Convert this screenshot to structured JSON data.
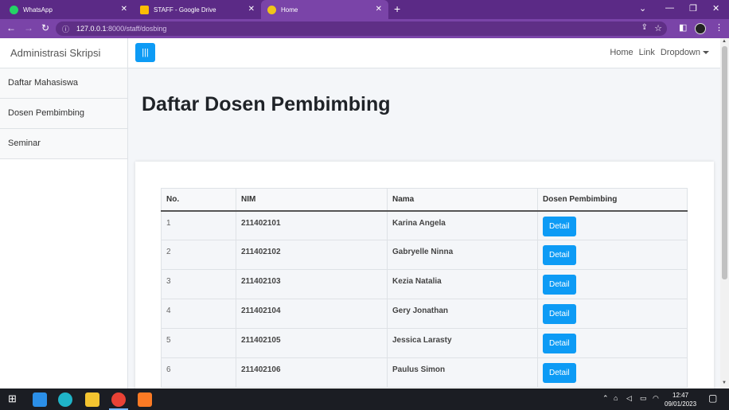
{
  "browser": {
    "tabs": [
      {
        "label": "WhatsApp",
        "color": "#25d366"
      },
      {
        "label": "STAFF - Google Drive",
        "color": "#fbbc04"
      },
      {
        "label": "Home",
        "color": "#f0c419"
      }
    ],
    "url_host": "127.0.0.1",
    "url_path": ":8000/staff/dosbing"
  },
  "sidebar": {
    "brand": "Administrasi Skripsi",
    "items": [
      {
        "label": "Daftar Mahasiswa"
      },
      {
        "label": "Dosen Pembimbing"
      },
      {
        "label": "Seminar"
      }
    ]
  },
  "navbar": {
    "toggle_icon": "|||",
    "links": [
      "Home",
      "Link"
    ],
    "dropdown": "Dropdown"
  },
  "main": {
    "title": "Daftar Dosen Pembimbing",
    "table": {
      "headers": [
        "No.",
        "NIM",
        "Nama",
        "Dosen Pembimbing"
      ],
      "button_label": "Detail",
      "rows": [
        {
          "no": "1",
          "nim": "211402101",
          "nama": "Karina Angela"
        },
        {
          "no": "2",
          "nim": "211402102",
          "nama": "Gabryelle Ninna"
        },
        {
          "no": "3",
          "nim": "211402103",
          "nama": "Kezia Natalia"
        },
        {
          "no": "4",
          "nim": "211402104",
          "nama": "Gery Jonathan"
        },
        {
          "no": "5",
          "nim": "211402105",
          "nama": "Jessica Larasty"
        },
        {
          "no": "6",
          "nim": "211402106",
          "nama": "Paulus Simon"
        }
      ]
    }
  },
  "taskbar": {
    "time": "12:47",
    "date": "09/01/2023"
  },
  "colors": {
    "accent": "#0d9bf5",
    "chrome": "#7a44a8"
  }
}
